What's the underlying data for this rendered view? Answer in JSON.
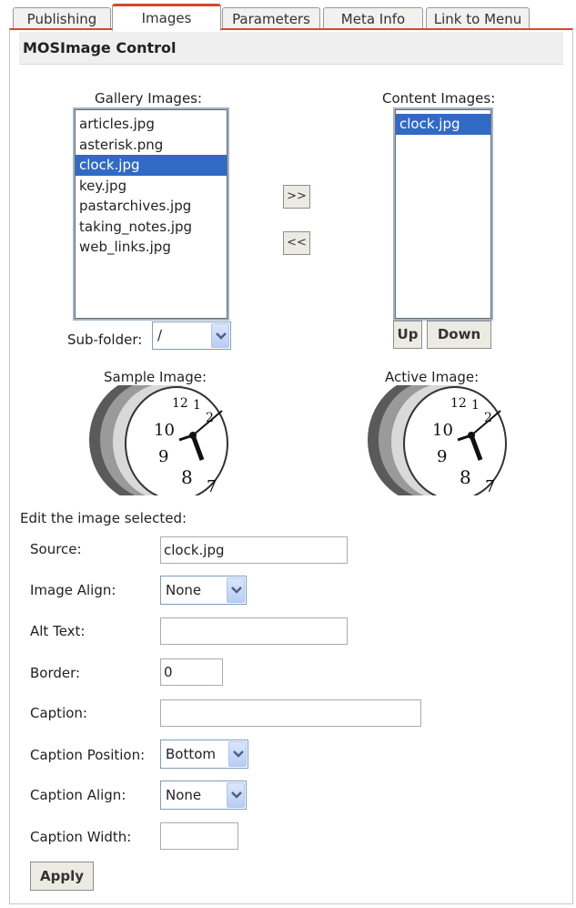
{
  "tabs": [
    {
      "label": "Publishing"
    },
    {
      "label": "Images"
    },
    {
      "label": "Parameters"
    },
    {
      "label": "Meta Info"
    },
    {
      "label": "Link to Menu"
    }
  ],
  "active_tab": "Images",
  "panel_title": "MOSImage Control",
  "gallery": {
    "label": "Gallery Images:",
    "items": [
      "articles.jpg",
      "asterisk.png",
      "clock.jpg",
      "key.jpg",
      "pastarchives.jpg",
      "taking_notes.jpg",
      "web_links.jpg"
    ],
    "selected": "clock.jpg"
  },
  "content": {
    "label": "Content Images:",
    "items": [
      "clock.jpg"
    ],
    "selected": "clock.jpg"
  },
  "move_buttons": {
    "add": ">>",
    "remove": "<<"
  },
  "order_buttons": {
    "up": "Up",
    "down": "Down"
  },
  "subfolder": {
    "label": "Sub-folder:",
    "value": "/"
  },
  "sample_image": {
    "label": "Sample Image:"
  },
  "active_image": {
    "label": "Active Image:"
  },
  "edit_section": {
    "title": "Edit the image selected:"
  },
  "fields": {
    "source": {
      "label": "Source:",
      "value": "clock.jpg"
    },
    "image_align": {
      "label": "Image Align:",
      "value": "None"
    },
    "alt_text": {
      "label": "Alt Text:",
      "value": ""
    },
    "border": {
      "label": "Border:",
      "value": "0"
    },
    "caption": {
      "label": "Caption:",
      "value": ""
    },
    "caption_position": {
      "label": "Caption Position:",
      "value": "Bottom"
    },
    "caption_align": {
      "label": "Caption Align:",
      "value": "None"
    },
    "caption_width": {
      "label": "Caption Width:",
      "value": ""
    }
  },
  "apply_button": "Apply",
  "colors": {
    "tab_accent": "#d34a2c",
    "selection": "#316ac5"
  },
  "icons": {
    "dropdown": "chevron-down-icon"
  }
}
